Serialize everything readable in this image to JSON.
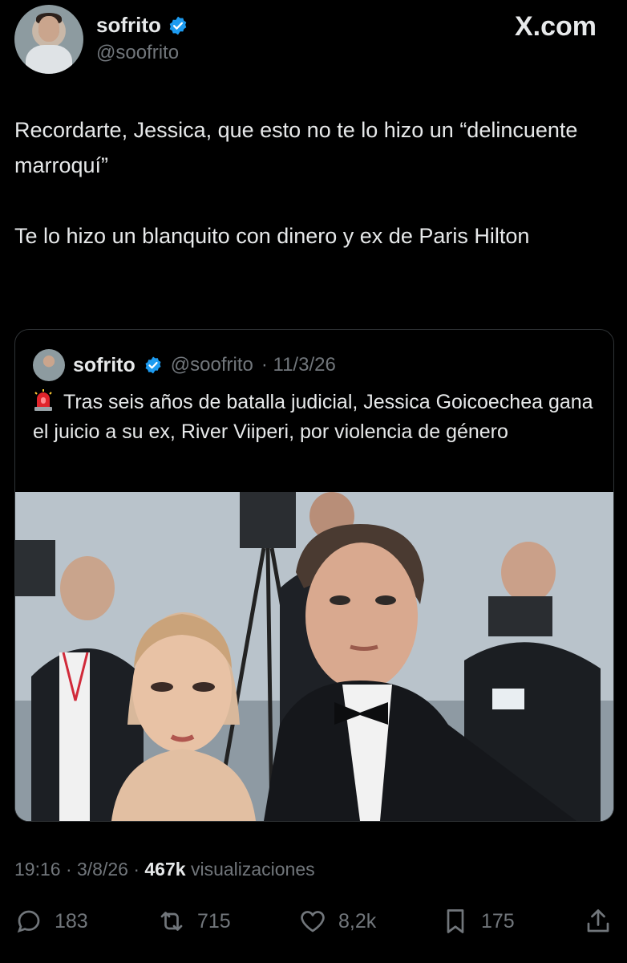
{
  "author": {
    "name": "sofrito",
    "handle": "@soofrito",
    "avatar_icon": "profile-photo"
  },
  "brand": "X.com",
  "tweet": {
    "paragraphs": [
      "Recordarte, Jessica, que esto no te lo hizo un “delincuente marroquí”",
      "Te lo hizo un blanquito con dinero y ex de Paris Hilton"
    ]
  },
  "quoted": {
    "name": "sofrito",
    "handle": "@soofrito",
    "date": "· 11/3/26",
    "emoji_icon": "rotating-light-icon",
    "text": "Tras seis años de batalla judicial, Jessica Goicoechea gana el juicio a su ex, River Viiperi, por violencia de género",
    "image": "photo-couple-red-carpet"
  },
  "meta": {
    "time": "19:16 · 3/8/26 ·",
    "views_count": "467k",
    "views_label": "visualizaciones"
  },
  "actions": {
    "replies": "183",
    "reposts": "715",
    "likes": "8,2k",
    "bookmarks": "175"
  },
  "colors": {
    "background": "#000000",
    "text": "#e7e9ea",
    "secondary": "#71767b",
    "verified": "#1d9bf0",
    "border": "#2f3336"
  }
}
